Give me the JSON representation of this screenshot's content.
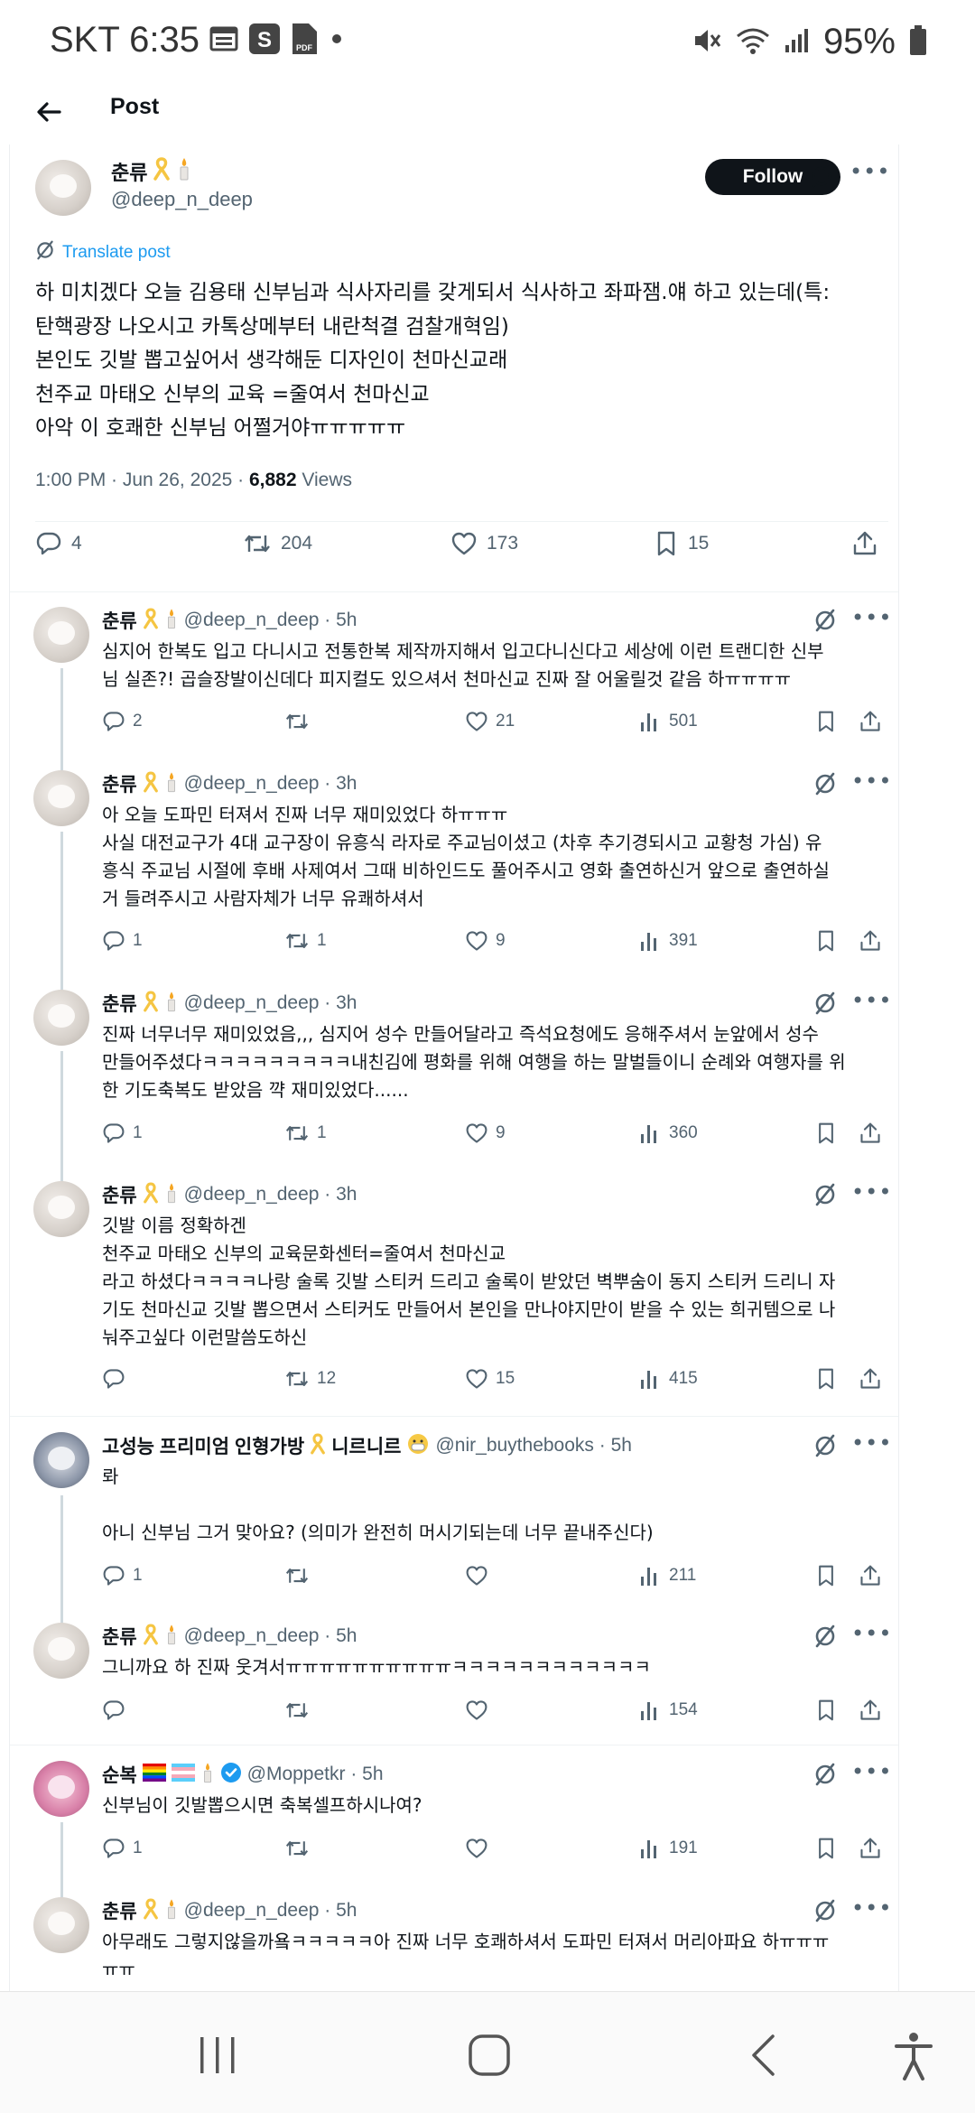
{
  "status_bar": {
    "time": "SKT 6:35",
    "battery": "95%"
  },
  "header": {
    "title": "Post"
  },
  "main_post": {
    "name": "춘류",
    "handle": "@deep_n_deep",
    "follow_label": "Follow",
    "translate_label": "Translate post",
    "lines": [
      "하 미치겠다 오늘 김용태 신부님과 식사자리를 갖게되서 식사하고 좌파잼.얘 하고 있는데(특:",
      "탄핵광장 나오시고 카톡상메부터 내란척결 검찰개혁임)",
      "본인도 깃발 뽑고싶어서 생각해둔 디자인이 천마신교래",
      "천주교 마태오 신부의 교육 =줄여서 천마신교",
      "아악 이 호쾌한 신부님 어쩔거야ㅠㅠㅠㅠㅠ"
    ],
    "time_date": "1:00 PM · Jun 26, 2025 · ",
    "views_count": "6,882",
    "views_label": " Views",
    "replies": "4",
    "reposts": "204",
    "likes": "173",
    "bookmarks": "15"
  },
  "replies": [
    {
      "name": "춘류",
      "handle": "@deep_n_deep · 5h",
      "lines": [
        "심지어 한복도 입고 다니시고 전통한복 제작까지해서 입고다니신다고 세상에 이런 트랜디한 신부",
        "님 실존?! 곱슬장발이신데다 피지컬도 있으셔서 천마신교 진짜 잘 어울릴것 같음 하ㅠㅠㅠㅠ"
      ],
      "replies": "2",
      "reposts": "",
      "likes": "21",
      "views": "501"
    },
    {
      "name": "춘류",
      "handle": "@deep_n_deep · 3h",
      "lines": [
        "아 오늘 도파민 터져서 진짜 너무 재미있었다 하ㅠㅠㅠ",
        "사실 대전교구가 4대 교구장이 유흥식 라자로 주교님이셨고 (차후 추기경되시고 교황청 가심) 유",
        "흥식 주교님 시절에 후배 사제여서 그때 비하인드도 풀어주시고 영화 출연하신거 앞으로 출연하실",
        "거 들려주시고 사람자체가 너무 유쾌하셔서"
      ],
      "replies": "1",
      "reposts": "1",
      "likes": "9",
      "views": "391"
    },
    {
      "name": "춘류",
      "handle": "@deep_n_deep · 3h",
      "lines": [
        "진짜 너무너무 재미있었음,,, 심지어 성수 만들어달라고 즉석요청에도 응해주셔서 눈앞에서 성수",
        "만들어주셨다ㅋㅋㅋㅋㅋㅋㅋㅋㅋ내친김에 평화를 위해 여행을 하는 말벌들이니 순례와 여행자를 위",
        "한 기도축복도 받았음 꺅 재미있었다......"
      ],
      "replies": "1",
      "reposts": "1",
      "likes": "9",
      "views": "360"
    },
    {
      "name": "춘류",
      "handle": "@deep_n_deep · 3h",
      "lines": [
        "깃발 이름 정확하겐",
        "천주교 마태오 신부의 교육문화센터=줄여서 천마신교",
        "라고 하셨다ㅋㅋㅋㅋ나랑 술록 깃발 스티커 드리고 술록이 받았던 벽뿌숨이 동지 스티커 드리니 자",
        "기도 천마신교 깃발 뽑으면서 스티커도 만들어서 본인을 만나야지만이 받을 수 있는 희귀템으로 나",
        "눠주고싶다 이런말씀도하신"
      ],
      "replies": "",
      "reposts": "12",
      "likes": "15",
      "views": "415"
    },
    {
      "name": "고성능 프리미엄 인형가방",
      "name_suffix": "니르니르",
      "handle": "@nir_buythebooks · 5h",
      "lines": [
        "롸",
        "",
        "아니 신부님 그거 맞아요? (의미가 완전히 머시기되는데 너무 끝내주신다)"
      ],
      "replies": "1",
      "reposts": "",
      "likes": "",
      "views": "211"
    },
    {
      "name": "춘류",
      "handle": "@deep_n_deep · 5h",
      "lines": [
        "그니까요 하 진짜 웃겨서ㅠㅠㅠㅠㅠㅠㅠㅠㅠㅠㅋㅋㅋㅋㅋㅋㅋㅋㅋㅋㅋㅋ"
      ],
      "replies": "",
      "reposts": "",
      "likes": "",
      "views": "154"
    },
    {
      "name": "순복",
      "handle": "@Moppetkr · 5h",
      "lines": [
        "신부님이 깃발뽑으시면 축복셀프하시나여?"
      ],
      "replies": "1",
      "reposts": "",
      "likes": "",
      "views": "191"
    },
    {
      "name": "춘류",
      "handle": "@deep_n_deep · 5h",
      "lines": [
        "아무래도 그렇지않을까욬ㅋㅋㅋㅋㅋ아 진짜 너무 호쾌하셔서 도파민 터져서 머리아파요 하ㅠㅠㅠ",
        "ㅠㅠ"
      ],
      "replies": "",
      "reposts": "",
      "likes": "",
      "views": ""
    }
  ],
  "colors": {
    "text": "#0f1419",
    "secondary": "#536471",
    "link": "#1d9bf0",
    "ribbon": "#f5c542"
  }
}
